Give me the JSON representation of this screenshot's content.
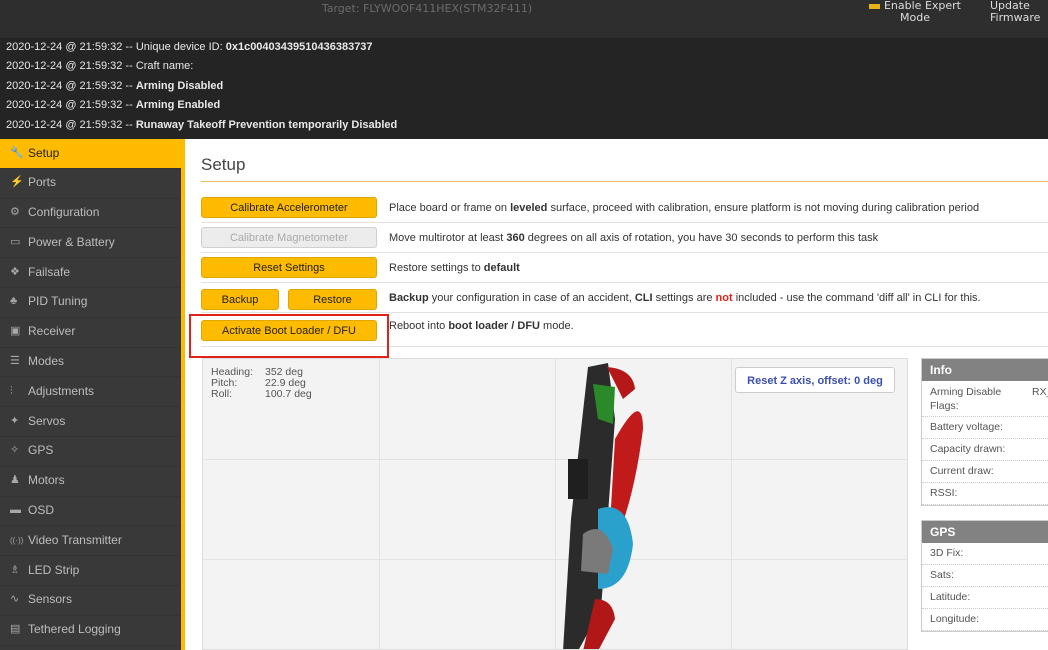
{
  "topbar": {
    "target": "Target: FLYWOOF411HEX(STM32F411)",
    "expert_mode_label": "Enable Expert Mode",
    "update_firmware_label": "Update Firmware"
  },
  "log": [
    {
      "time": "2020-12-24 @ 21:59:32",
      "prefix": "Unique device ID: ",
      "text": "0x1c00403439510436383737"
    },
    {
      "time": "2020-12-24 @ 21:59:32",
      "prefix": "Craft name: ",
      "text": ""
    },
    {
      "time": "2020-12-24 @ 21:59:32",
      "prefix": "",
      "text": "Arming Disabled"
    },
    {
      "time": "2020-12-24 @ 21:59:32",
      "prefix": "",
      "text": "Arming Enabled"
    },
    {
      "time": "2020-12-24 @ 21:59:32",
      "prefix": "",
      "text": "Runaway Takeoff Prevention temporarily Disabled"
    }
  ],
  "sidebar": {
    "items": [
      {
        "label": "Setup",
        "icon": "wrench-icon",
        "glyph": "🔧"
      },
      {
        "label": "Ports",
        "icon": "plug-icon",
        "glyph": "⚡"
      },
      {
        "label": "Configuration",
        "icon": "gear-icon",
        "glyph": "⚙"
      },
      {
        "label": "Power & Battery",
        "icon": "battery-icon",
        "glyph": "▭"
      },
      {
        "label": "Failsafe",
        "icon": "failsafe-icon",
        "glyph": "❖"
      },
      {
        "label": "PID Tuning",
        "icon": "pid-icon",
        "glyph": "♣"
      },
      {
        "label": "Receiver",
        "icon": "receiver-icon",
        "glyph": "▣"
      },
      {
        "label": "Modes",
        "icon": "modes-icon",
        "glyph": "☰"
      },
      {
        "label": "Adjustments",
        "icon": "adjustments-icon",
        "glyph": "⫶"
      },
      {
        "label": "Servos",
        "icon": "servo-icon",
        "glyph": "✦"
      },
      {
        "label": "GPS",
        "icon": "satellite-icon",
        "glyph": "✧"
      },
      {
        "label": "Motors",
        "icon": "motor-icon",
        "glyph": "♟"
      },
      {
        "label": "OSD",
        "icon": "osd-icon",
        "glyph": "▬"
      },
      {
        "label": "Video Transmitter",
        "icon": "vtx-icon",
        "glyph": "((·))"
      },
      {
        "label": "LED Strip",
        "icon": "led-icon",
        "glyph": "♗"
      },
      {
        "label": "Sensors",
        "icon": "sensors-icon",
        "glyph": "∿"
      },
      {
        "label": "Tethered Logging",
        "icon": "logging-icon",
        "glyph": "▤"
      }
    ]
  },
  "setup": {
    "title": "Setup",
    "calibrate_acc": "Calibrate Accelerometer",
    "calibrate_acc_desc_1": "Place board or frame on ",
    "calibrate_acc_desc_bold": "leveled",
    "calibrate_acc_desc_2": " surface, proceed with calibration, ensure platform is not moving during calibration period",
    "calibrate_mag": "Calibrate Magnetometer",
    "calibrate_mag_desc_1": "Move multirotor at least ",
    "calibrate_mag_desc_bold": "360",
    "calibrate_mag_desc_2": " degrees on all axis of rotation, you have 30 seconds to perform this task",
    "reset": "Reset Settings",
    "reset_desc_1": "Restore settings to ",
    "reset_desc_bold": "default",
    "backup": "Backup",
    "restore": "Restore",
    "backup_desc_bold": "Backup",
    "backup_desc_1": " your configuration in case of an accident, ",
    "backup_desc_bold2": "CLI",
    "backup_desc_2": " settings are ",
    "backup_desc_red": "not",
    "backup_desc_3": " included - use the command 'diff all' in CLI for this.",
    "boot": "Activate Boot Loader / DFU",
    "boot_desc_1": "Reboot into ",
    "boot_desc_bold": "boot loader / DFU",
    "boot_desc_2": " mode."
  },
  "attitude": {
    "heading_label": "Heading:",
    "heading": "352 deg",
    "pitch_label": "Pitch:",
    "pitch": "22.9 deg",
    "roll_label": "Roll:",
    "roll": "100.7 deg",
    "reset_z": "Reset Z axis, offset: 0 deg"
  },
  "info": {
    "title": "Info",
    "arming_label": "Arming Disable Flags:",
    "arming_value": "RX_",
    "battery_voltage": "Battery voltage:",
    "capacity_drawn": "Capacity drawn:",
    "current_draw": "Current draw:",
    "rssi": "RSSI:"
  },
  "gps": {
    "title": "GPS",
    "fix": "3D Fix:",
    "sats": "Sats:",
    "latitude": "Latitude:",
    "longitude": "Longitude:"
  },
  "colors": {
    "accent": "#ffbb00",
    "highlight": "#e0231a",
    "sidebar_bg": "#393939"
  }
}
